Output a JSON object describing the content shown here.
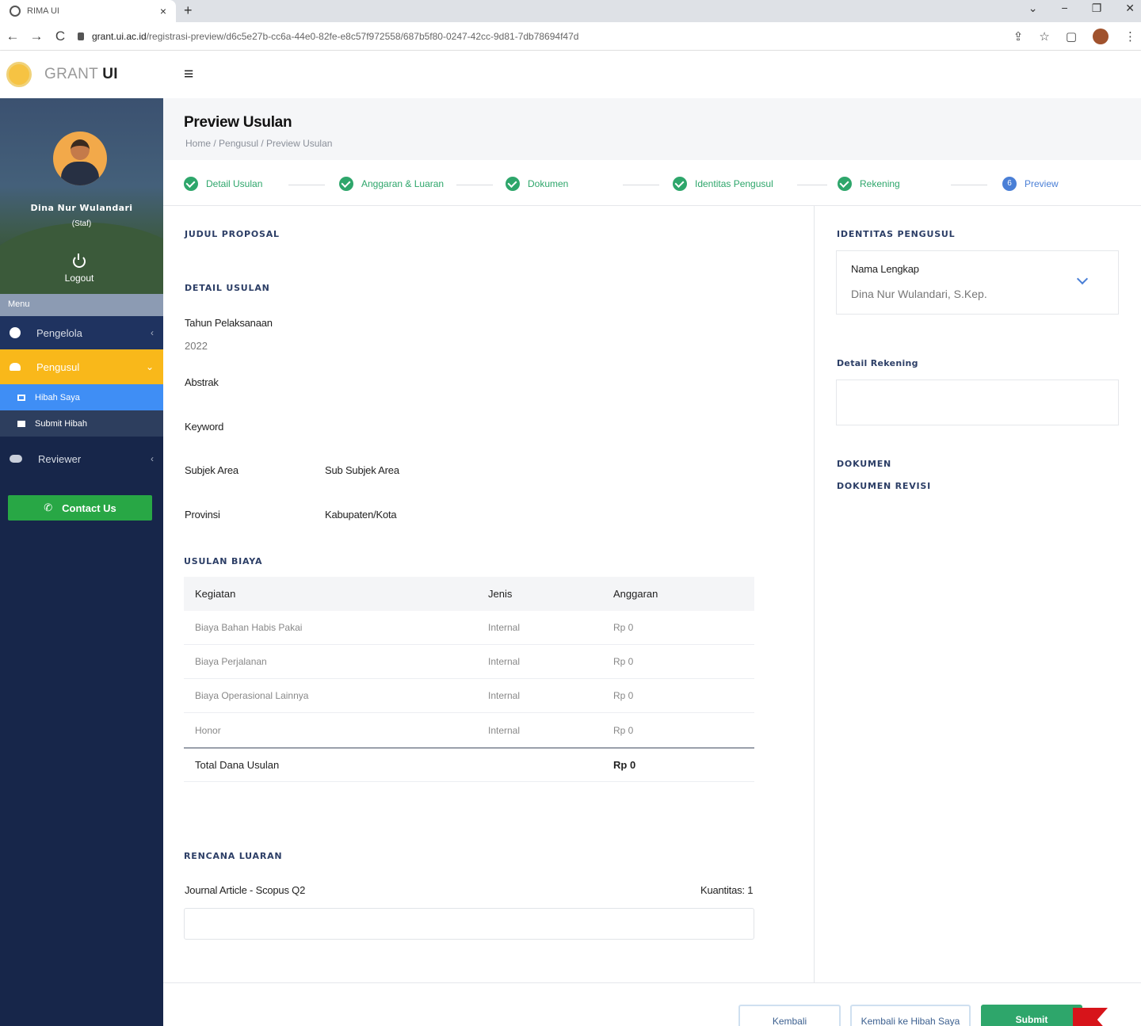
{
  "browser": {
    "tab_title": "RIMA UI",
    "tab_close": "×",
    "new_tab": "+",
    "url_host": "grant.ui.ac.id",
    "url_path": "/registrasi-preview/d6c5e27b-cc6a-44e0-82fe-e8c57f972558/687b5f80-0247-42cc-9d81-7db78694f47d",
    "back": "←",
    "forward": "→",
    "reload": "C",
    "minimize": "−",
    "restore": "❐",
    "close": "✕",
    "menu_down": "⌄",
    "share": "⇪",
    "star": "☆",
    "sidepanel": "▢",
    "more": "⋮"
  },
  "header": {
    "brand_prefix": "GRANT",
    "brand_suffix": "UI",
    "menu_toggle": "≡"
  },
  "sidebar": {
    "profile_name": "Dina Nur Wulandari",
    "profile_role": "(Staf)",
    "logout": "Logout",
    "menu_header": "Menu",
    "items": [
      {
        "label": "Pengelola",
        "chevron": "‹"
      },
      {
        "label": "Pengusul",
        "chevron": "⌄"
      },
      {
        "label": "Reviewer",
        "chevron": "‹"
      }
    ],
    "subitems": [
      {
        "label": "Hibah Saya"
      },
      {
        "label": "Submit Hibah"
      }
    ],
    "contact_label": "Contact Us",
    "contact_icon": "✆"
  },
  "page": {
    "title": "Preview Usulan",
    "breadcrumb": "Home / Pengusul / Preview Usulan"
  },
  "steps": [
    {
      "label": "Detail Usulan"
    },
    {
      "label": "Anggaran & Luaran"
    },
    {
      "label": "Dokumen"
    },
    {
      "label": "Identitas Pengusul"
    },
    {
      "label": "Rekening"
    },
    {
      "label": "Preview",
      "number": "6"
    }
  ],
  "left": {
    "judul_title": "JUDUL PROPOSAL",
    "detail_title": "DETAIL USULAN",
    "tahun_label": "Tahun Pelaksanaan",
    "tahun_value": "2022",
    "abstrak_label": "Abstrak",
    "keyword_label": "Keyword",
    "subjek_label": "Subjek Area",
    "subsubjek_label": "Sub Subjek Area",
    "provinsi_label": "Provinsi",
    "kabupaten_label": "Kabupaten/Kota",
    "biaya_title": "USULAN BIAYA",
    "table": {
      "headers": [
        "Kegiatan",
        "Jenis",
        "Anggaran"
      ],
      "rows": [
        [
          "Biaya Bahan Habis Pakai",
          "Internal",
          "Rp 0"
        ],
        [
          "Biaya Perjalanan",
          "Internal",
          "Rp 0"
        ],
        [
          "Biaya Operasional Lainnya",
          "Internal",
          "Rp 0"
        ],
        [
          "Honor",
          "Internal",
          "Rp 0"
        ]
      ],
      "total_label": "Total Dana Usulan",
      "total_value": "Rp 0"
    },
    "luaran_title": "RENCANA LUARAN",
    "luaran_item": "Journal Article - Scopus Q2",
    "luaran_qty": "Kuantitas: 1"
  },
  "right": {
    "identitas_title": "IDENTITAS PENGUSUL",
    "nama_label": "Nama Lengkap",
    "nama_value": "Dina Nur Wulandari, S.Kep.",
    "rekening_title": "Detail Rekening",
    "dokumen_title": "DOKUMEN",
    "dokumen_revisi_title": "DOKUMEN REVISI"
  },
  "footer": {
    "kembali": "Kembali",
    "kembali_hibah": "Kembali ke Hibah Saya",
    "submit": "Submit"
  }
}
